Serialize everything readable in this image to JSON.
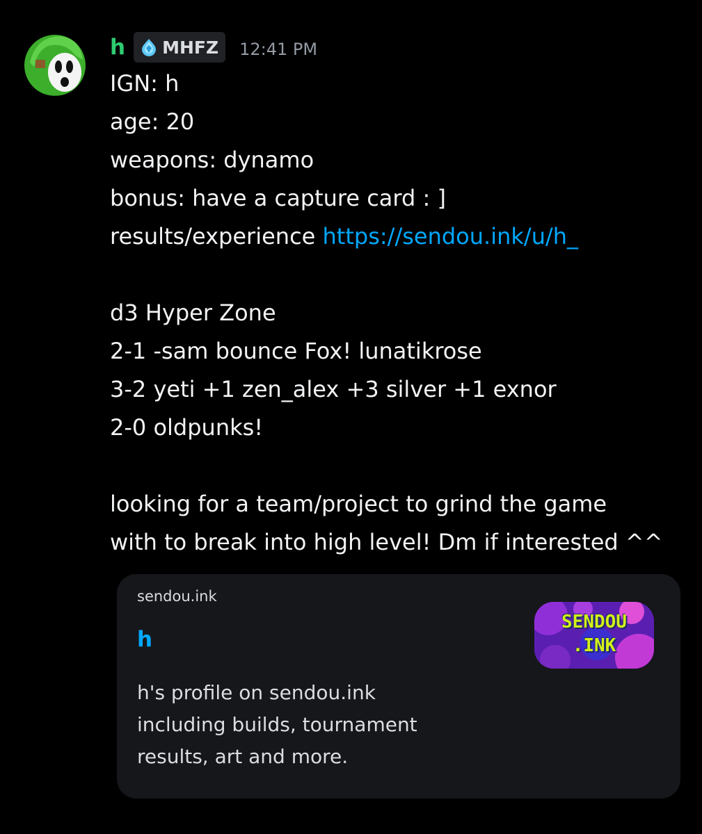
{
  "author": {
    "name": "h",
    "tag_icon": "diamond-icon",
    "tag_label": "MHFZ",
    "timestamp": "12:41 PM",
    "avatar_icon": "shy-guy-avatar-icon",
    "name_color": "#2fcc71"
  },
  "message": {
    "lines": {
      "ign": "IGN: h",
      "age": "age: 20",
      "weapons": "weapons: dynamo",
      "bonus": "bonus: have a capture card : ]",
      "results_prefix": "results/experience ",
      "results_link": "https://sendou.ink/u/h_",
      "hyper_zone": "d3 Hyper Zone",
      "result_1": "2-1 -sam bounce Fox! lunatikrose",
      "result_2": "3-2 yeti +1 zen_alex +3 silver +1 exnor",
      "result_3": "2-0 oldpunks!",
      "closing_1": "looking for a team/project to grind the game",
      "closing_2": "with to break into high level! Dm if interested ^^"
    },
    "link_color": "#00a8fc"
  },
  "embed": {
    "provider": "sendou.ink",
    "title": "h",
    "description_lines": {
      "l1": "h's profile on sendou.ink",
      "l2": "including builds, tournament",
      "l3": "results, art and more."
    },
    "thumbnail": {
      "line1": "SENDOU",
      "line2": ".INK"
    }
  }
}
